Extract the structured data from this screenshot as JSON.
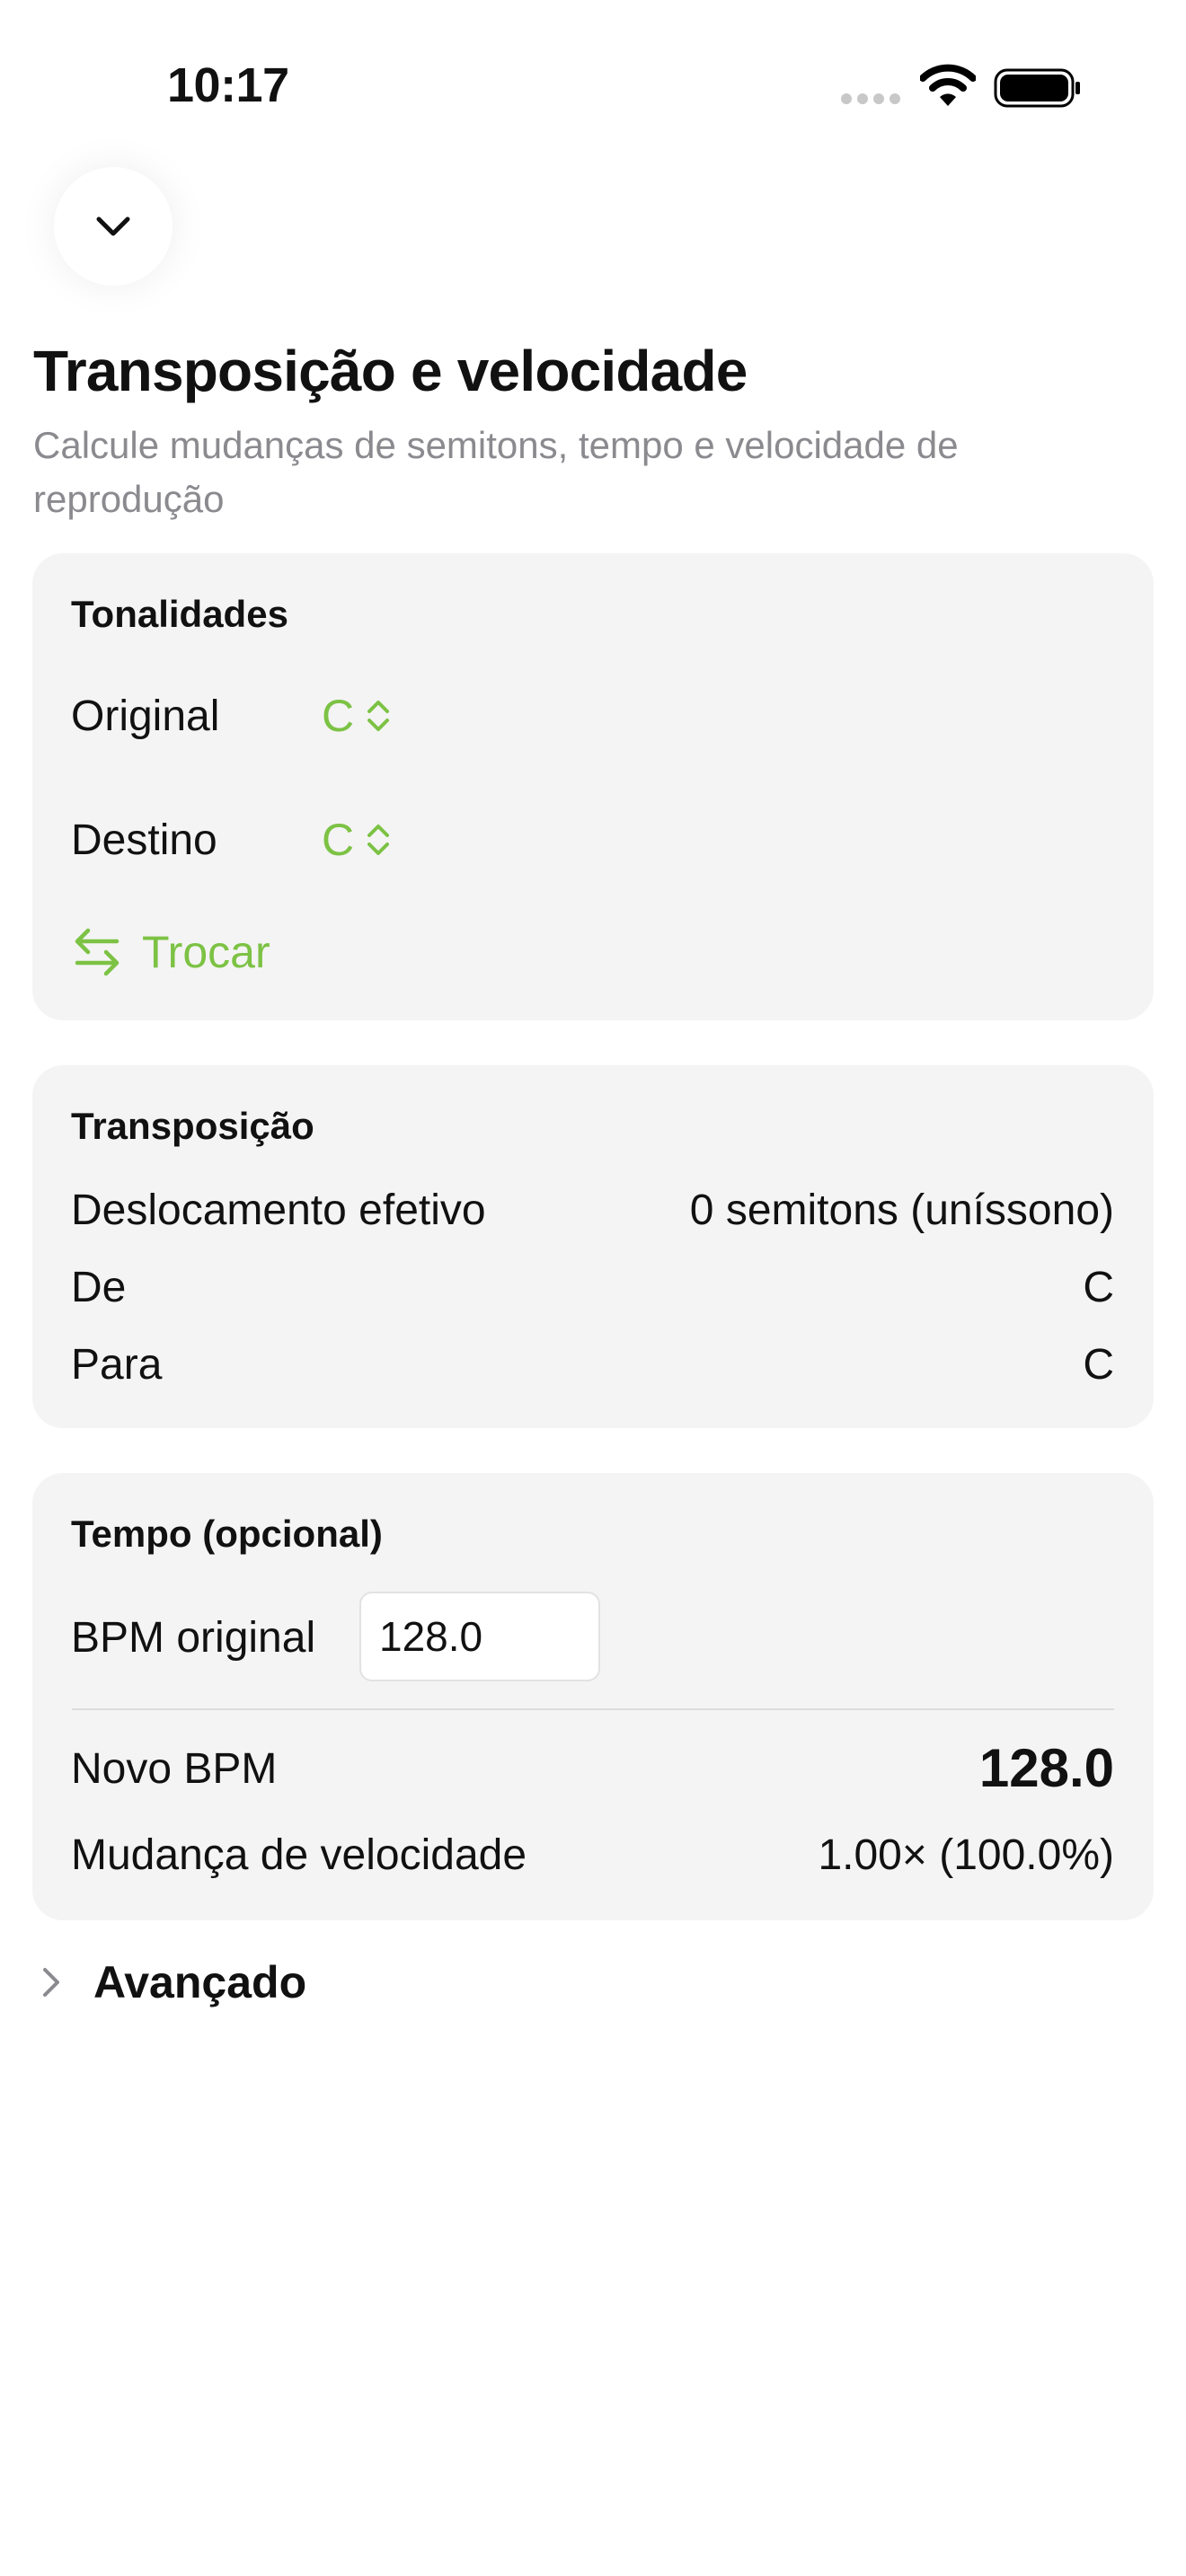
{
  "status_bar": {
    "time": "10:17"
  },
  "header": {
    "title": "Transposição e velocidade",
    "subtitle": "Calcule mudanças de semitons, tempo e velocidade de reprodução"
  },
  "keys": {
    "title": "Tonalidades",
    "original_label": "Original",
    "original_value": "C",
    "target_label": "Destino",
    "target_value": "C",
    "swap_label": "Trocar"
  },
  "transposition": {
    "title": "Transposição",
    "rows": [
      {
        "label": "Deslocamento efetivo",
        "value": "0 semitons (uníssono)"
      },
      {
        "label": "De",
        "value": "C"
      },
      {
        "label": "Para",
        "value": "C"
      }
    ]
  },
  "tempo": {
    "title": "Tempo (opcional)",
    "bpm_label": "BPM original",
    "bpm_value": "128.0",
    "new_bpm_label": "Novo BPM",
    "new_bpm_value": "128.0",
    "speed_label": "Mudança de velocidade",
    "speed_value": "1.00× (100.0%)"
  },
  "advanced": {
    "label": "Avançado"
  },
  "colors": {
    "accent": "#7cc244",
    "card": "#f4f4f4",
    "secondary_text": "#8a8a8f"
  }
}
